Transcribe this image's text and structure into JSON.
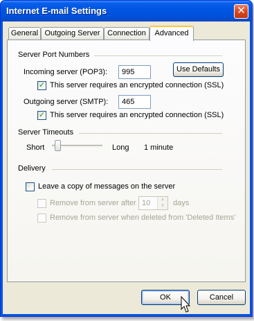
{
  "window": {
    "title": "Internet E-mail Settings"
  },
  "tabs": [
    {
      "label": "General"
    },
    {
      "label": "Outgoing Server"
    },
    {
      "label": "Connection"
    },
    {
      "label": "Advanced"
    }
  ],
  "server_ports": {
    "heading": "Server Port Numbers",
    "incoming_label": "Incoming server (POP3):",
    "incoming_value": "995",
    "use_defaults_label": "Use Defaults",
    "incoming_ssl_label": "This server requires an encrypted connection (SSL)",
    "incoming_ssl_checked": true,
    "outgoing_label": "Outgoing server (SMTP):",
    "outgoing_value": "465",
    "outgoing_ssl_label": "This server requires an encrypted connection (SSL)",
    "outgoing_ssl_checked": true
  },
  "timeouts": {
    "heading": "Server Timeouts",
    "short_label": "Short",
    "long_label": "Long",
    "value_text": "1 minute",
    "slider_level": 0.07
  },
  "delivery": {
    "heading": "Delivery",
    "leave_copy_label": "Leave a copy of messages on the server",
    "leave_copy_checked": false,
    "remove_after_label": "Remove from server after",
    "remove_after_value": "10",
    "days_label": "days",
    "remove_deleted_label": "Remove from server when deleted from 'Deleted Items'"
  },
  "footer": {
    "ok_label": "OK",
    "cancel_label": "Cancel"
  }
}
